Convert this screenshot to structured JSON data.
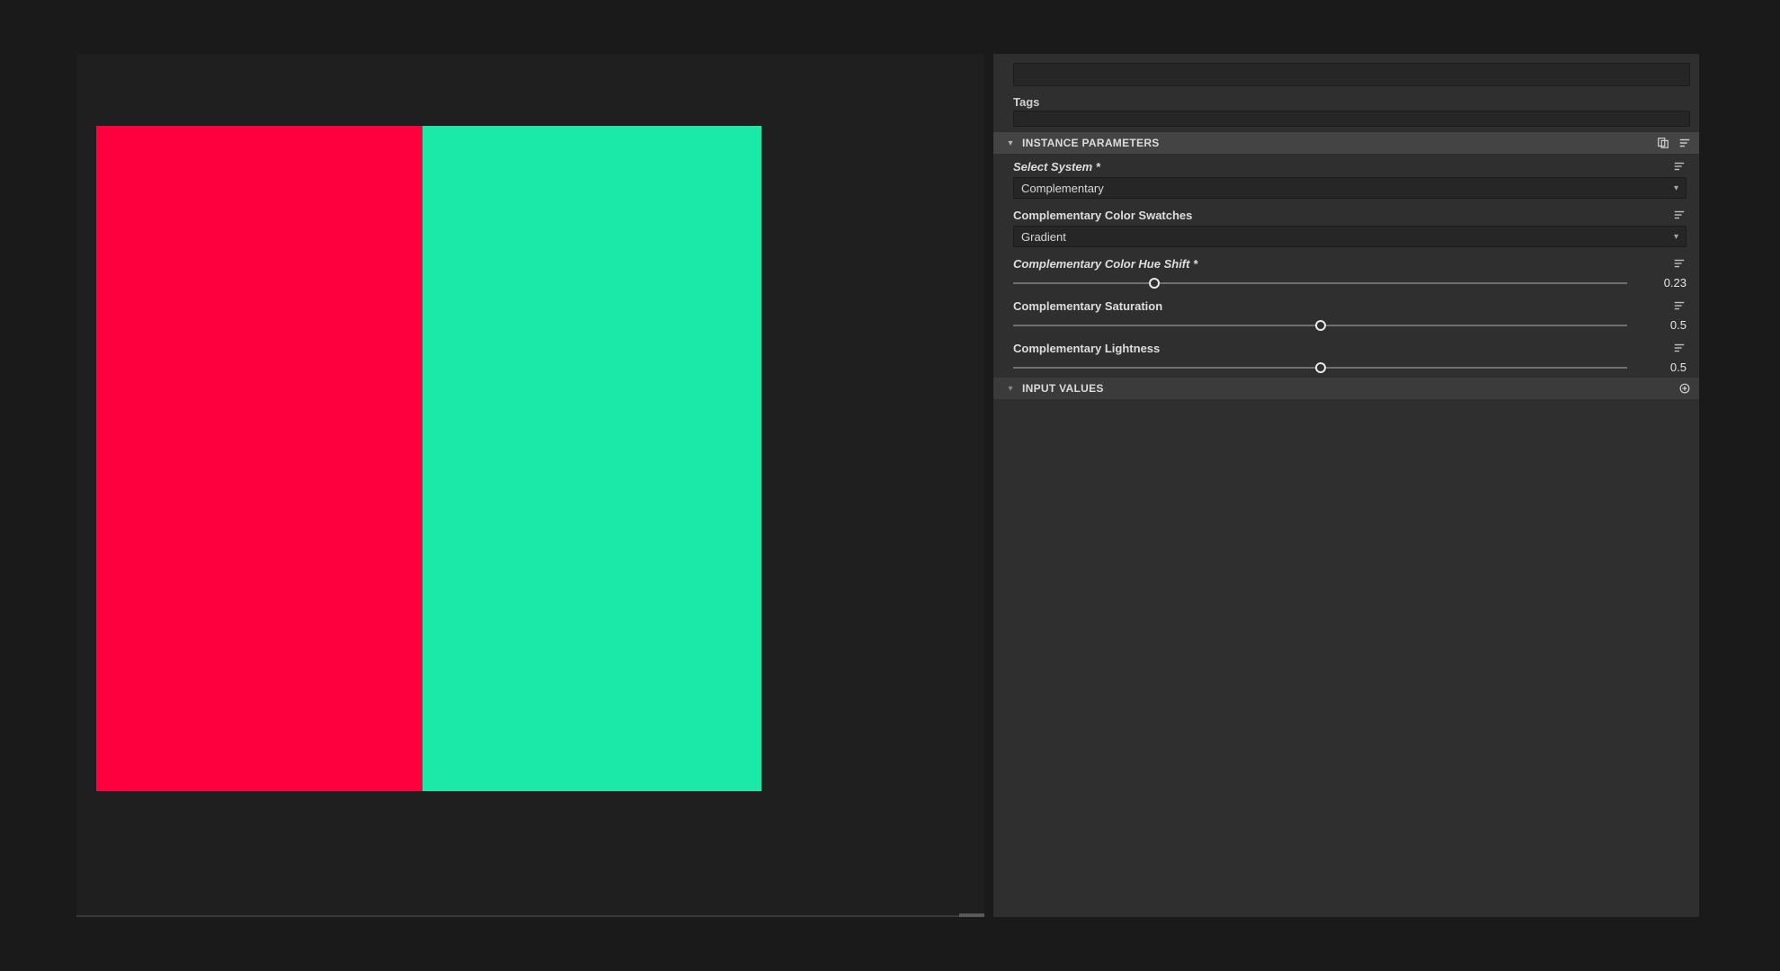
{
  "colors": {
    "swatch_left": "#ff003e",
    "swatch_right": "#1be9a8"
  },
  "top": {
    "unnamed_value": "",
    "tags_label": "Tags",
    "tags_value": ""
  },
  "sections": {
    "instance_parameters": "INSTANCE PARAMETERS",
    "input_values": "INPUT VALUES"
  },
  "params": {
    "select_system": {
      "label": "Select System *",
      "value": "Complementary"
    },
    "swatches": {
      "label": "Complementary Color Swatches",
      "value": "Gradient"
    },
    "hue_shift": {
      "label": "Complementary Color Hue Shift *",
      "value": "0.23",
      "fraction": 0.23
    },
    "saturation": {
      "label": "Complementary Saturation",
      "value": "0.5",
      "fraction": 0.5
    },
    "lightness": {
      "label": "Complementary Lightness",
      "value": "0.5",
      "fraction": 0.5
    }
  }
}
